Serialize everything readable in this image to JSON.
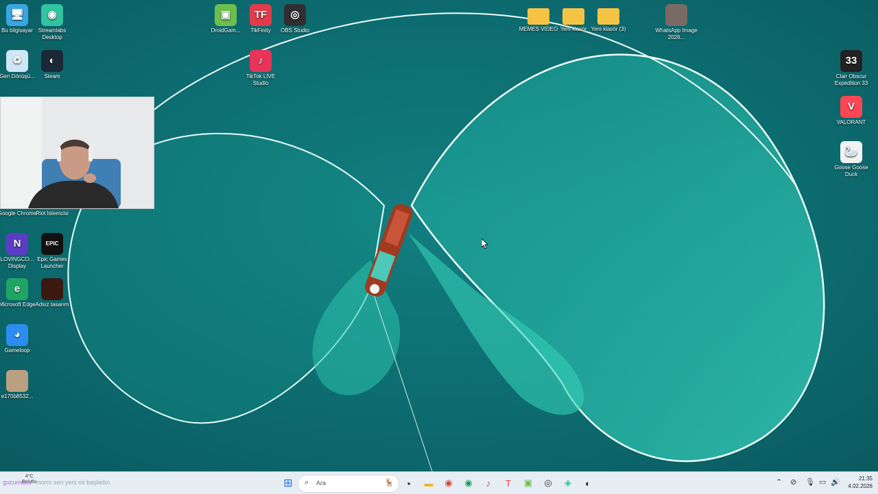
{
  "desktop": {
    "icons": [
      {
        "label": "Bu bilgisayar",
        "icon": "monitor-icon",
        "color": "#3aa6e0",
        "glyph": "🖥"
      },
      {
        "label": "Streamlabs Desktop",
        "icon": "streamlabs-icon",
        "color": "#31c3a2",
        "glyph": "◉"
      },
      {
        "label": "DroidGam...",
        "icon": "android-icon",
        "color": "#6cc04a",
        "glyph": "▣"
      },
      {
        "label": "TikFinity",
        "icon": "tikfinity-icon",
        "color": "#e23b4b",
        "glyph": "TF"
      },
      {
        "label": "OBS Studio",
        "icon": "obs-icon",
        "color": "#302e31",
        "glyph": "◎"
      },
      {
        "label": "MEMES VIDEO",
        "icon": "folder-icon",
        "color": "#f6c445",
        "glyph": ""
      },
      {
        "label": "Yeni klasör",
        "icon": "folder-icon",
        "color": "#f6c445",
        "glyph": ""
      },
      {
        "label": "Yeni klasör (3)",
        "icon": "folder-icon",
        "color": "#f6c445",
        "glyph": ""
      },
      {
        "label": "WhatsApp Image 2026...",
        "icon": "image-file-icon",
        "color": "#7a6a66",
        "glyph": ""
      },
      {
        "label": "Geri Dönüşü...",
        "icon": "recycle-bin-icon",
        "color": "#cfe6f5",
        "glyph": "♻"
      },
      {
        "label": "Steam",
        "icon": "steam-icon",
        "color": "#1b2838",
        "glyph": "◐"
      },
      {
        "label": "TikTok LIVE Studio",
        "icon": "tiktok-icon",
        "color": "#e8345a",
        "glyph": "♪"
      },
      {
        "label": "Clair Obscur Expedition 33",
        "icon": "game-icon",
        "color": "#222222",
        "glyph": "33"
      },
      {
        "label": "VALORANT",
        "icon": "valorant-icon",
        "color": "#ff4655",
        "glyph": "V"
      },
      {
        "label": "Goose Goose Duck",
        "icon": "goose-icon",
        "color": "#f2f2f2",
        "glyph": "🦢"
      },
      {
        "label": "Google Chrome",
        "icon": "chrome-icon",
        "color": "#4285f4",
        "glyph": ""
      },
      {
        "label": "Riot İstemcisi",
        "icon": "riot-icon",
        "color": "#d13639",
        "glyph": ""
      },
      {
        "label": "LOVINGCO... Display",
        "icon": "display-app-icon",
        "color": "#5b3cc4",
        "glyph": "N"
      },
      {
        "label": "Epic Games Launcher",
        "icon": "epic-games-icon",
        "color": "#111111",
        "glyph": "EPIC"
      },
      {
        "label": "Microsoft Edge",
        "icon": "edge-icon",
        "color": "#1fa463",
        "glyph": "e"
      },
      {
        "label": "Adsız tasarım",
        "icon": "design-file-icon",
        "color": "#3a1a10",
        "glyph": ""
      },
      {
        "label": "Gameloop",
        "icon": "gameloop-icon",
        "color": "#2d8cf0",
        "glyph": "◕"
      },
      {
        "label": "e170b8532...",
        "icon": "photo-file-icon",
        "color": "#b8a080",
        "glyph": ""
      }
    ]
  },
  "taskbar": {
    "weather_temp": "4°C",
    "weather_desc": "Bulutlu",
    "chat_user": "gucumuzu",
    "chat_message": "morro sen yeni mi başladın",
    "search_placeholder": "Ara",
    "apps": [
      {
        "name": "windows-start-icon",
        "glyph": "⊞",
        "color": "#1a73e8"
      },
      {
        "name": "task-view-icon",
        "glyph": "▪",
        "color": "#333333"
      },
      {
        "name": "file-explorer-icon",
        "glyph": "▬",
        "color": "#f0b429"
      },
      {
        "name": "chrome-icon",
        "glyph": "◉",
        "color": "#db4437"
      },
      {
        "name": "chrome-profile-icon",
        "glyph": "◉",
        "color": "#0f9d58"
      },
      {
        "name": "tiktok-live-icon",
        "glyph": "♪",
        "color": "#e8345a"
      },
      {
        "name": "tikfinity-icon",
        "glyph": "T",
        "color": "#e23b4b"
      },
      {
        "name": "droidgamer-icon",
        "glyph": "▣",
        "color": "#6cc04a"
      },
      {
        "name": "obs-icon",
        "glyph": "◎",
        "color": "#302e31"
      },
      {
        "name": "streamlabs-icon",
        "glyph": "◈",
        "color": "#31c3a2"
      },
      {
        "name": "steam-icon",
        "glyph": "◐",
        "color": "#1b2838"
      }
    ],
    "clock_time": "21:35",
    "clock_date": "4.02.2026"
  },
  "colors": {
    "sea": "#0e6f73",
    "net": "#39d3bd",
    "taskbar": "#e6eef4"
  }
}
